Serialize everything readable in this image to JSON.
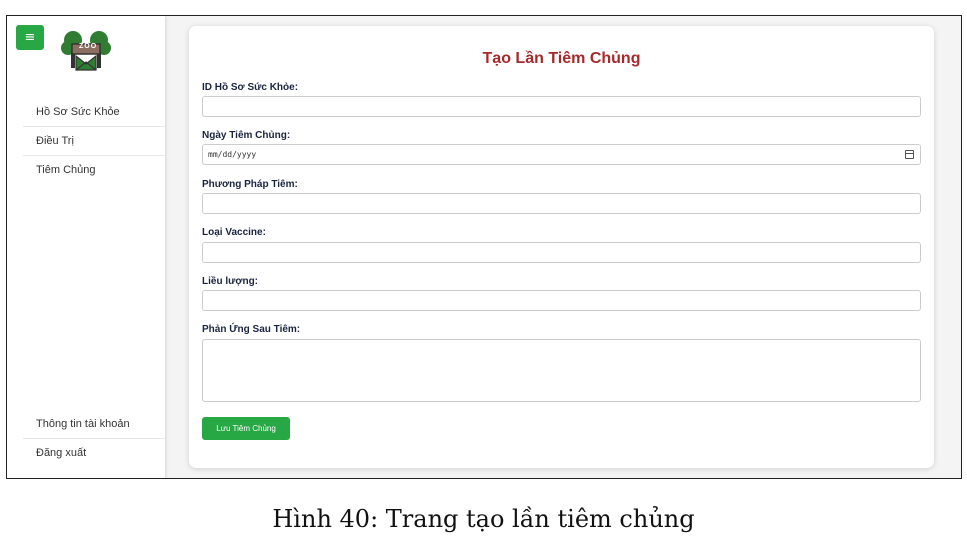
{
  "sidebar": {
    "menu_icon": "hamburger-icon",
    "logo": {
      "icon": "zoo-logo-icon",
      "text": "ZOO",
      "color": "#2e7d32"
    },
    "items": [
      {
        "label": "Hồ Sơ Sức Khỏe"
      },
      {
        "label": "Điều Trị"
      },
      {
        "label": "Tiêm Chủng"
      }
    ],
    "bottom_items": [
      {
        "label": "Thông tin tài khoản"
      },
      {
        "label": "Đăng xuất"
      }
    ]
  },
  "form": {
    "title": "Tạo Lần Tiêm Chủng",
    "title_color": "#a52a2a",
    "fields": [
      {
        "label": "ID Hồ Sơ Sức Khỏe:",
        "value": ""
      },
      {
        "label": "Ngày Tiêm Chủng:",
        "placeholder": "mm/dd/yyyy",
        "icon": "calendar-icon"
      },
      {
        "label": "Phương Pháp Tiêm:",
        "value": ""
      },
      {
        "label": "Loại Vaccine:",
        "value": ""
      },
      {
        "label": "Liều lượng:",
        "value": ""
      },
      {
        "label": "Phản Ứng Sau Tiêm:",
        "value": ""
      }
    ],
    "submit_label": "Lưu Tiêm Chủng",
    "accent_color": "#28a745"
  },
  "caption": "Hình 40: Trang tạo lần tiêm chủng"
}
